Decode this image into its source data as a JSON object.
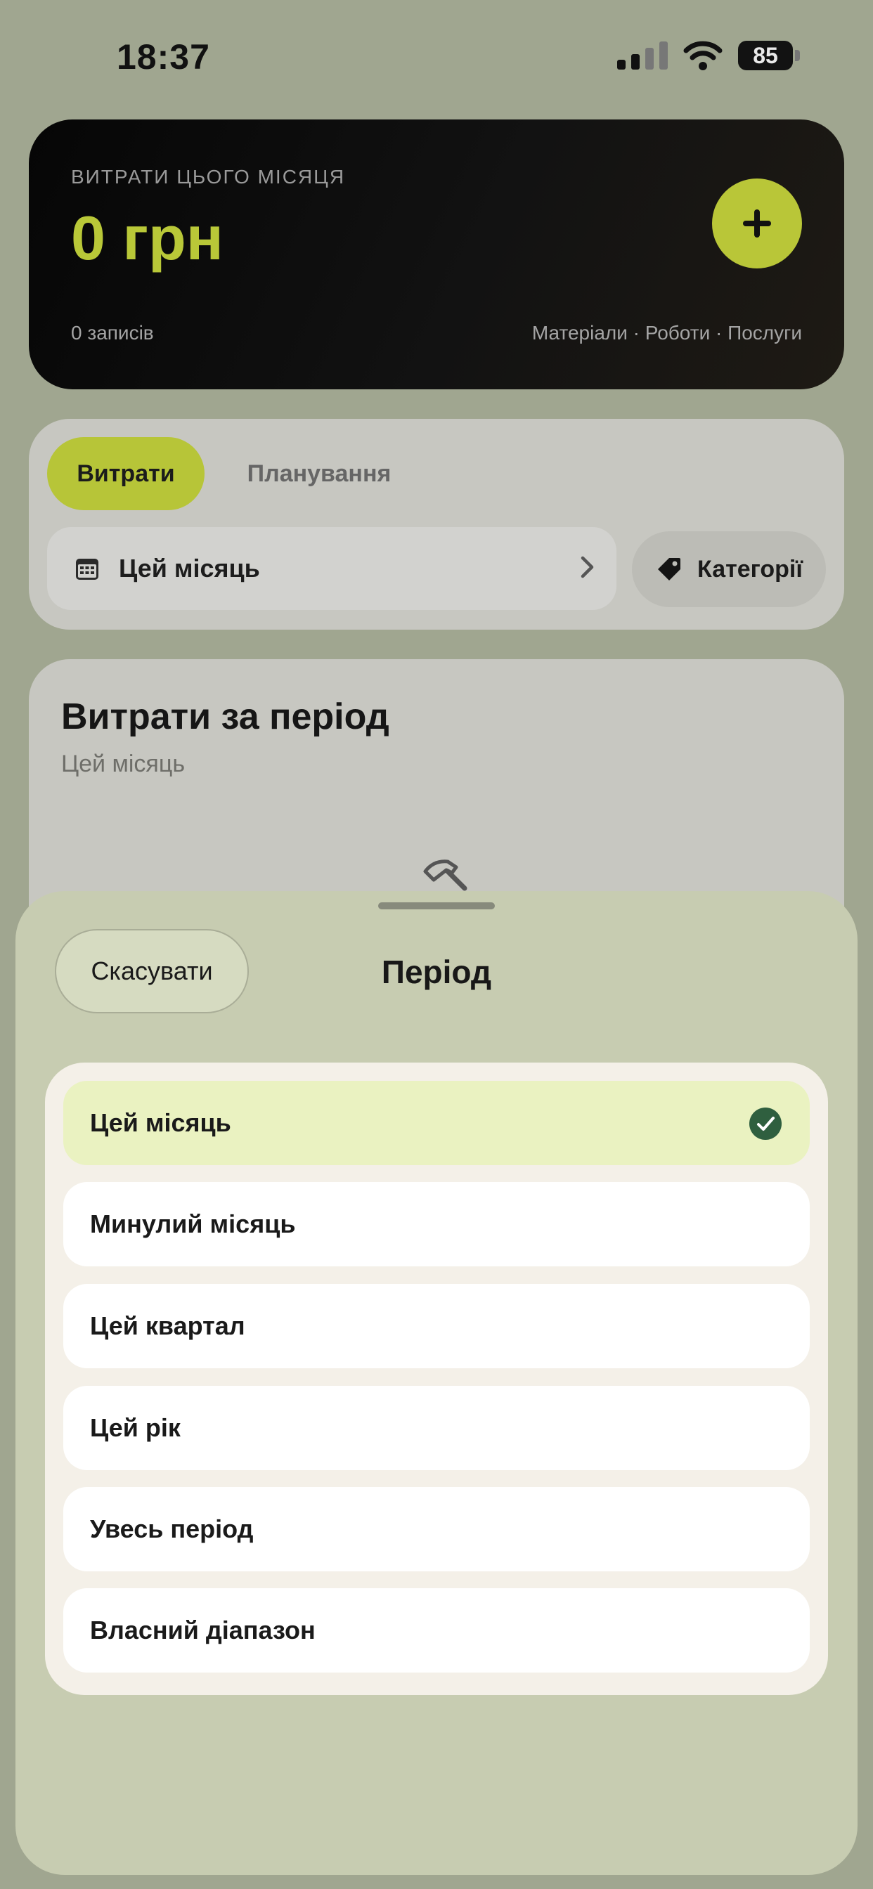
{
  "status_bar": {
    "time": "18:37",
    "battery": "85"
  },
  "hero": {
    "label": "ВИТРАТИ ЦЬОГО МІСЯЦЯ",
    "amount": "0 грн",
    "records": "0 записів",
    "categories_line": "Матеріали · Роботи · Послуги",
    "add_icon": "plus-icon"
  },
  "tabs": [
    {
      "label": "Витрати",
      "active": true
    },
    {
      "label": "Планування",
      "active": false
    }
  ],
  "period_field": {
    "label": "Цей місяць",
    "icon": "calendar-icon"
  },
  "categories_button": {
    "label": "Категорії",
    "icon": "tag-icon"
  },
  "summary": {
    "title": "Витрати за період",
    "subtitle": "Цей місяць",
    "icon": "hammer-icon"
  },
  "sheet": {
    "cancel_label": "Скасувати",
    "title": "Період",
    "options": [
      {
        "label": "Цей місяць",
        "selected": true
      },
      {
        "label": "Минулий місяць",
        "selected": false
      },
      {
        "label": "Цей квартал",
        "selected": false
      },
      {
        "label": "Цей рік",
        "selected": false
      },
      {
        "label": "Увесь період",
        "selected": false
      },
      {
        "label": "Власний діапазон",
        "selected": false
      }
    ]
  },
  "colors": {
    "accent": "#b9c638",
    "selected_option": "#eaf2c1",
    "check": "#2f5f3f"
  }
}
